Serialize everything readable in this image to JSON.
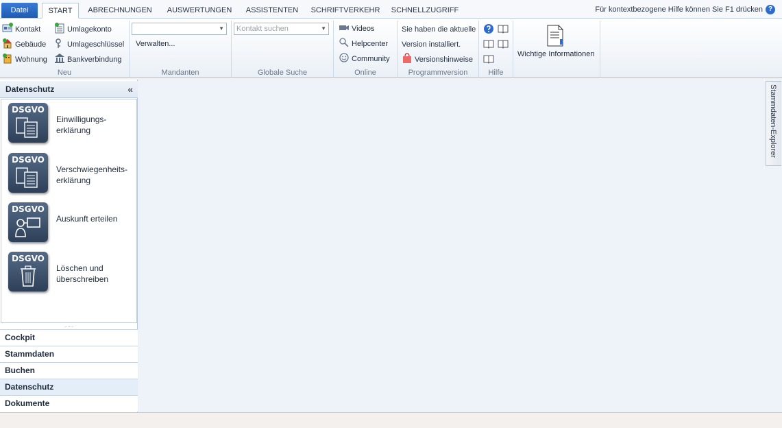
{
  "tabs": {
    "file": "Datei",
    "items": [
      "START",
      "ABRECHNUNGEN",
      "AUSWERTUNGEN",
      "ASSISTENTEN",
      "SCHRIFTVERKEHR",
      "SCHNELLZUGRIFF"
    ],
    "active": "START",
    "help_hint": "Für kontextbezogene Hilfe können Sie F1 drücken",
    "help_glyph": "?"
  },
  "ribbon": {
    "neu": {
      "label": "Neu",
      "kontakt": "Kontakt",
      "gebaeude": "Gebäude",
      "wohnung": "Wohnung",
      "umlagekonto": "Umlagekonto",
      "umlageschluessel": "Umlageschlüssel",
      "bankverbindung": "Bankverbindung"
    },
    "mandanten": {
      "label": "Mandanten",
      "verwalten": "Verwalten..."
    },
    "suche": {
      "label": "Globale Suche",
      "placeholder": "Kontakt suchen"
    },
    "online": {
      "label": "Online",
      "videos": "Videos",
      "helpcenter": "Helpcenter",
      "community": "Community"
    },
    "programmversion": {
      "label": "Programmversion",
      "line1": "Sie haben die aktuelle",
      "line2": "Version installiert.",
      "versionshinweise": "Versionshinweise"
    },
    "hilfe": {
      "label": "Hilfe"
    },
    "wichtige": {
      "label": "Wichtige Informationen"
    }
  },
  "nav": {
    "header": "Datenschutz",
    "collapse_glyph": "«",
    "tile_label": "DSGVO",
    "items": [
      {
        "line1": "Einwilligungs-",
        "line2": "erklärung"
      },
      {
        "line1": "Verschwiegenheits-",
        "line2": "erklärung"
      },
      {
        "line1": "Auskunft erteilen",
        "line2": ""
      },
      {
        "line1": "Löschen und",
        "line2": "überschreiben"
      }
    ],
    "splitter_glyph": "......",
    "sections": [
      "Cockpit",
      "Stammdaten",
      "Buchen",
      "Datenschutz",
      "Dokumente"
    ],
    "active_section": "Datenschutz"
  },
  "side_panel": {
    "label": "Stammdaten-Explorer"
  },
  "colors": {
    "accent": "#2d6ccc",
    "tile": "#3c5069",
    "content_bg": "#eef3f9"
  }
}
